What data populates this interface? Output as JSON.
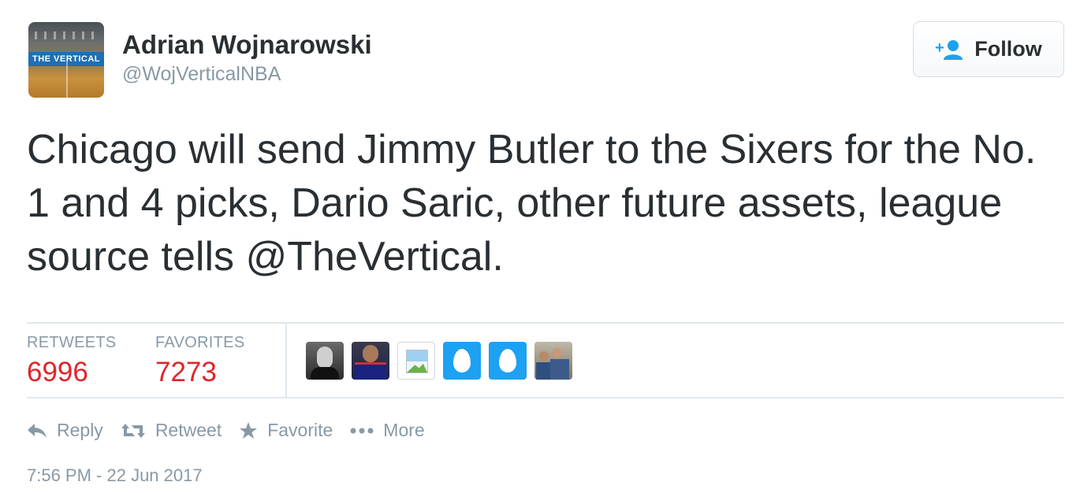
{
  "author": {
    "name": "Adrian Wojnarowski",
    "handle": "@WojVerticalNBA",
    "avatar_banner": "THE VERTICAL"
  },
  "follow_button": {
    "label": "Follow",
    "icon": "add-user-icon"
  },
  "tweet": {
    "text": "Chicago will send Jimmy Butler to the Sixers for the No. 1 and 4 picks, Dario Saric, other future assets, league source tells @TheVertical."
  },
  "stats": {
    "retweets_label": "RETWEETS",
    "retweets_count": "6996",
    "favorites_label": "FAVORITES",
    "favorites_count": "7273"
  },
  "favoriters": [
    {
      "kind": "portrait"
    },
    {
      "kind": "player"
    },
    {
      "kind": "broken-image"
    },
    {
      "kind": "egg"
    },
    {
      "kind": "egg"
    },
    {
      "kind": "group-photo"
    }
  ],
  "actions": [
    {
      "label": "Reply",
      "icon": "reply-icon"
    },
    {
      "label": "Retweet",
      "icon": "retweet-icon"
    },
    {
      "label": "Favorite",
      "icon": "star-icon"
    },
    {
      "label": "More",
      "icon": "more-dots-icon"
    }
  ],
  "timestamp": "7:56 PM - 22 Jun 2017",
  "colors": {
    "count_red": "#e0242b",
    "muted_gray": "#8899a6",
    "text_dark": "#292f33",
    "twitter_blue": "#1da1f2"
  }
}
